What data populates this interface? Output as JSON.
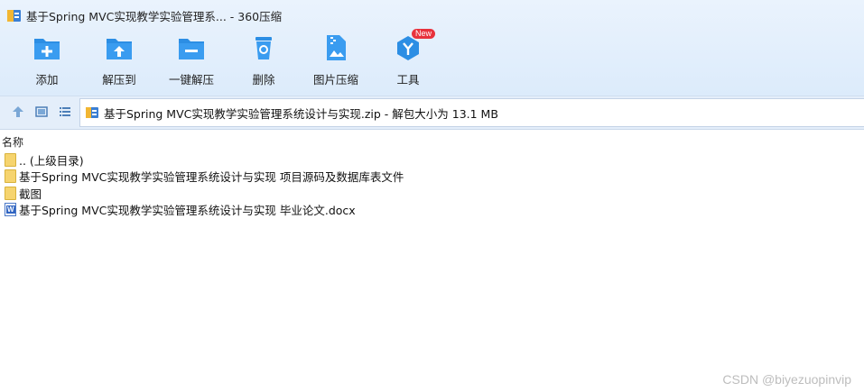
{
  "window": {
    "title": "基于Spring MVC实现教学实验管理系... - 360压缩"
  },
  "toolbar": {
    "items": [
      {
        "label": "添加"
      },
      {
        "label": "解压到"
      },
      {
        "label": "一键解压"
      },
      {
        "label": "删除"
      },
      {
        "label": "图片压缩"
      },
      {
        "label": "工具",
        "badge": "New"
      }
    ]
  },
  "path": {
    "text": "基于Spring MVC实现教学实验管理系统设计与实现.zip - 解包大小为 13.1 MB"
  },
  "columns": {
    "name": "名称"
  },
  "files": [
    {
      "name": ".. (上级目录)"
    },
    {
      "name": "基于Spring MVC实现教学实验管理系统设计与实现 项目源码及数据库表文件"
    },
    {
      "name": "截图"
    },
    {
      "name": "基于Spring MVC实现教学实验管理系统设计与实现 毕业论文.docx"
    }
  ],
  "watermark": "CSDN @biyezuopinvip",
  "colors": {
    "accent": "#2c8ee4",
    "badge": "#e8323c",
    "folder": "#f6d46e"
  }
}
